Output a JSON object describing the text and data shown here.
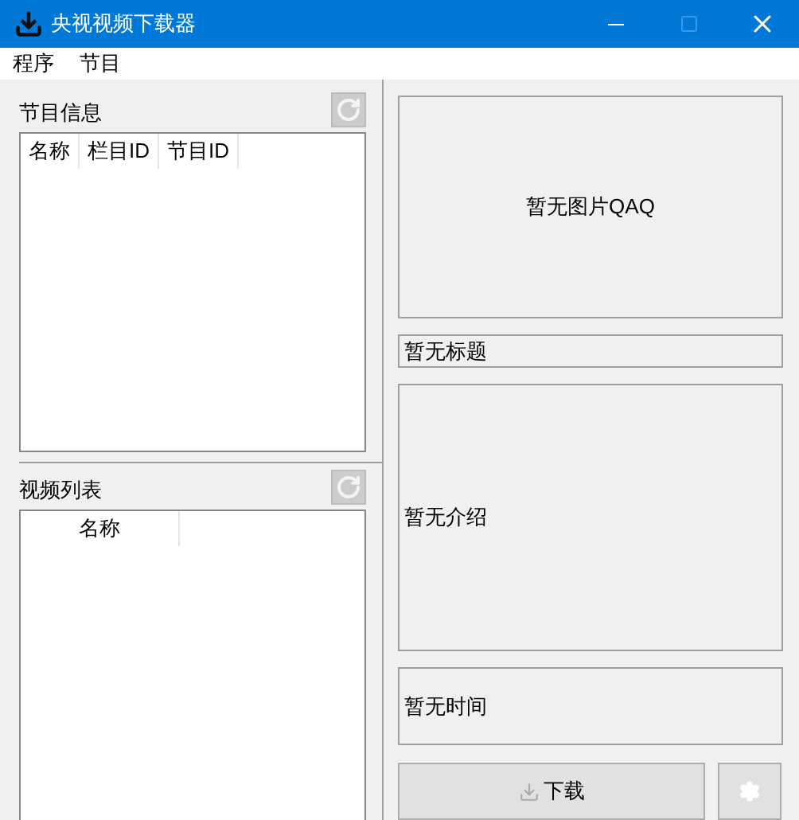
{
  "window": {
    "title": "央视视频下载器",
    "maximize_disabled": true
  },
  "menu": [
    {
      "label": "程序"
    },
    {
      "label": "节目"
    }
  ],
  "program_info": {
    "title": "节目信息",
    "refresh_disabled": true,
    "columns": [
      "名称",
      "栏目ID",
      "节目ID"
    ]
  },
  "video_list": {
    "title": "视频列表",
    "refresh_disabled": true,
    "columns": [
      "名称"
    ]
  },
  "details": {
    "image": "暂无图片QAQ",
    "title": "暂无标题",
    "intro": "暂无介绍",
    "time": "暂无时间"
  },
  "download_button": "下载"
}
